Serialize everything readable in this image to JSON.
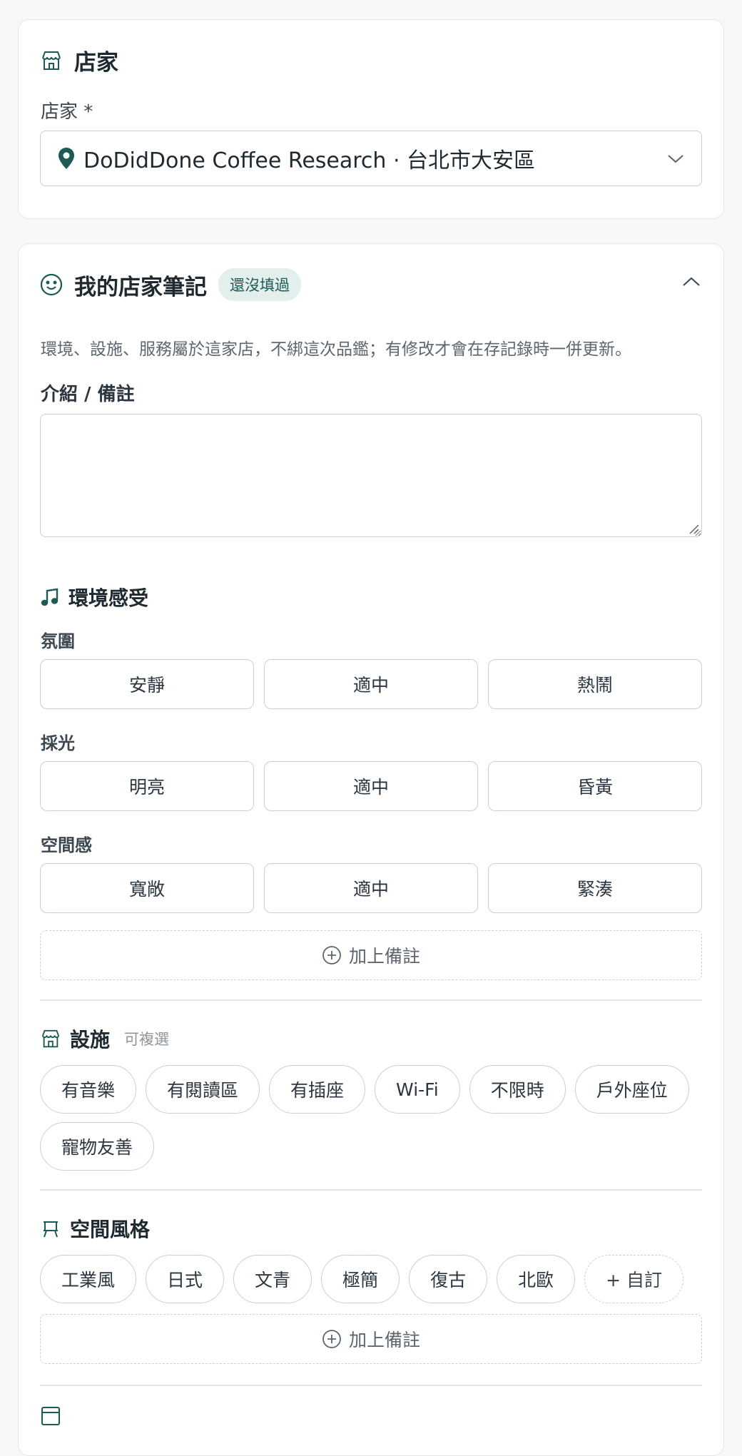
{
  "store_card": {
    "title": "店家",
    "field_label": "店家 *",
    "selected_store": "DoDidDone Coffee Research · 台北市大安區"
  },
  "notes_card": {
    "title": "我的店家筆記",
    "badge": "還沒填過",
    "hint": "環境、設施、服務屬於這家店，不綁這次品鑑；有修改才會在存記錄時一併更新。",
    "intro_label": "介紹 / 備註",
    "intro_value": "",
    "environment": {
      "title": "環境感受",
      "groups": [
        {
          "label": "氛圍",
          "options": [
            "安靜",
            "適中",
            "熱鬧"
          ]
        },
        {
          "label": "採光",
          "options": [
            "明亮",
            "適中",
            "昏黃"
          ]
        },
        {
          "label": "空間感",
          "options": [
            "寬敞",
            "適中",
            "緊湊"
          ]
        }
      ],
      "add_note": "加上備註"
    },
    "facilities": {
      "title": "設施",
      "subtitle": "可複選",
      "options": [
        "有音樂",
        "有閱讀區",
        "有插座",
        "Wi-Fi",
        "不限時",
        "戶外座位",
        "寵物友善"
      ]
    },
    "style": {
      "title": "空間風格",
      "options": [
        "工業風",
        "日式",
        "文青",
        "極簡",
        "復古",
        "北歐"
      ],
      "custom": "+ 自訂",
      "add_note": "加上備註"
    }
  },
  "colors": {
    "accent": "#1d5a55",
    "border": "#c9cfd4"
  }
}
